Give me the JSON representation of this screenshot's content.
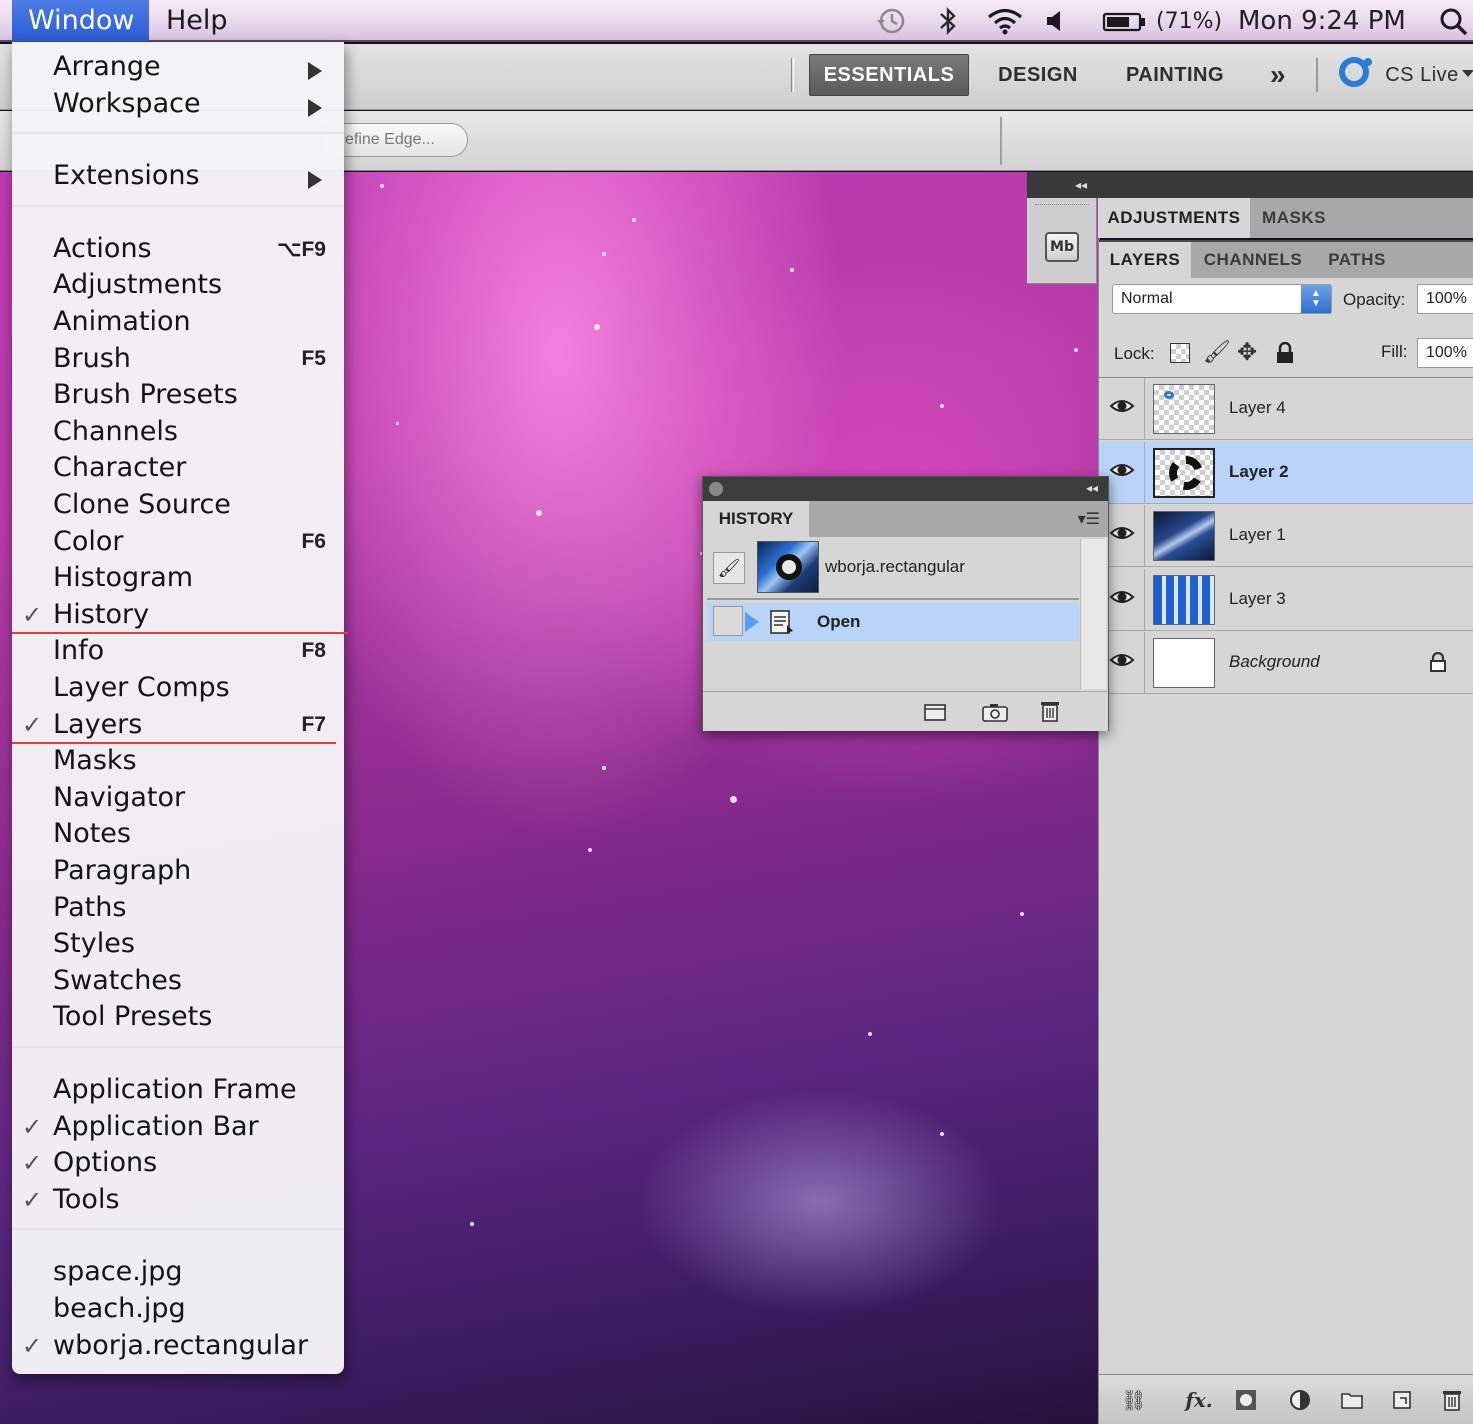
{
  "menubar": {
    "menus": [
      {
        "label": "Window",
        "active": true
      },
      {
        "label": "Help",
        "active": false
      }
    ],
    "battery": "(71%)",
    "clock": "Mon 9:24 PM"
  },
  "appbar": {
    "workspaces": [
      "ESSENTIALS",
      "DESIGN",
      "PAINTING"
    ],
    "active_workspace": "ESSENTIALS",
    "more": "»",
    "cs_live": "CS Live"
  },
  "options_bar": {
    "refine_edge": "efine Edge..."
  },
  "window_menu": {
    "groups": [
      [
        {
          "label": "Arrange",
          "submenu": true
        },
        {
          "label": "Workspace",
          "submenu": true
        }
      ],
      [
        {
          "label": "Extensions",
          "submenu": true
        }
      ],
      [
        {
          "label": "Actions",
          "shortcut": "⌥F9"
        },
        {
          "label": "Adjustments"
        },
        {
          "label": "Animation"
        },
        {
          "label": "Brush",
          "shortcut": "F5"
        },
        {
          "label": "Brush Presets"
        },
        {
          "label": "Channels"
        },
        {
          "label": "Character"
        },
        {
          "label": "Clone Source"
        },
        {
          "label": "Color",
          "shortcut": "F6"
        },
        {
          "label": "Histogram"
        },
        {
          "label": "History",
          "checked": true
        },
        {
          "label": "Info",
          "shortcut": "F8"
        },
        {
          "label": "Layer Comps"
        },
        {
          "label": "Layers",
          "checked": true,
          "shortcut": "F7"
        },
        {
          "label": "Masks"
        },
        {
          "label": "Navigator"
        },
        {
          "label": "Notes"
        },
        {
          "label": "Paragraph"
        },
        {
          "label": "Paths"
        },
        {
          "label": "Styles"
        },
        {
          "label": "Swatches"
        },
        {
          "label": "Tool Presets"
        }
      ],
      [
        {
          "label": "Application Frame"
        },
        {
          "label": "Application Bar",
          "checked": true
        },
        {
          "label": "Options",
          "checked": true
        },
        {
          "label": "Tools",
          "checked": true
        }
      ],
      [
        {
          "label": "space.jpg"
        },
        {
          "label": "beach.jpg"
        },
        {
          "label": "wborja.rectangular",
          "checked": true
        }
      ]
    ],
    "checkmark": "✓",
    "highlight_color": "#e8393b"
  },
  "adjustments_panel": {
    "tabs": [
      "ADJUSTMENTS",
      "MASKS"
    ],
    "active_tab": "ADJUSTMENTS",
    "dock_icon": "Mb"
  },
  "layers_panel": {
    "tabs": [
      "LAYERS",
      "CHANNELS",
      "PATHS"
    ],
    "active_tab": "LAYERS",
    "blend_mode": "Normal",
    "opacity_label": "Opacity:",
    "opacity": "100%",
    "lock_label": "Lock:",
    "fill_label": "Fill:",
    "fill": "100%",
    "layers": [
      {
        "name": "Layer 4",
        "selected": false,
        "thumb": "checker-dot"
      },
      {
        "name": "Layer 2",
        "selected": true,
        "thumb": "ring"
      },
      {
        "name": "Layer 1",
        "selected": false,
        "thumb": "photo"
      },
      {
        "name": "Layer 3",
        "selected": false,
        "thumb": "stripes"
      },
      {
        "name": "Background",
        "selected": false,
        "thumb": "white",
        "locked": true
      }
    ],
    "footer_fx": "fx."
  },
  "history_panel": {
    "tab": "HISTORY",
    "snapshot": "wborja.rectangular",
    "states": [
      {
        "label": "Open",
        "selected": true
      }
    ]
  },
  "colors": {
    "selection_blue": "#b8d4f8",
    "menu_active": "#2b5bd6"
  }
}
